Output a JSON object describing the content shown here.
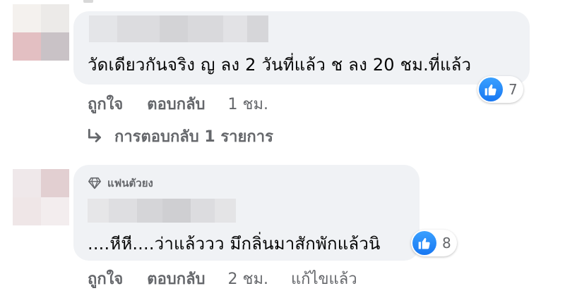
{
  "comments": [
    {
      "text": "วัดเดียวกันจริง ญ ลง 2 วันที่แล้ว ช ลง 20 ชม.ที่แล้ว",
      "reaction_icon": "like-icon",
      "reaction_count": "7",
      "actions": {
        "like": "ถูกใจ",
        "reply": "ตอบกลับ",
        "time": "1 ชม."
      },
      "replies_link": "การตอบกลับ 1 รายการ"
    },
    {
      "badge": "แฟนตัวยง",
      "badge_icon": "diamond-icon",
      "text": "....หีหี....ว่าแล้ววว มึกลิ่นมาสักพักแล้วนิ",
      "reaction_icon": "like-icon",
      "reaction_count": "8",
      "actions": {
        "like": "ถูกใจ",
        "reply": "ตอบกลับ",
        "time": "2 ชม.",
        "edited": "แก้ไขแล้ว"
      }
    }
  ],
  "colors": {
    "bubble": "#f0f2f5",
    "secondary_text": "#65676b",
    "like_blue": "#1877f2"
  }
}
